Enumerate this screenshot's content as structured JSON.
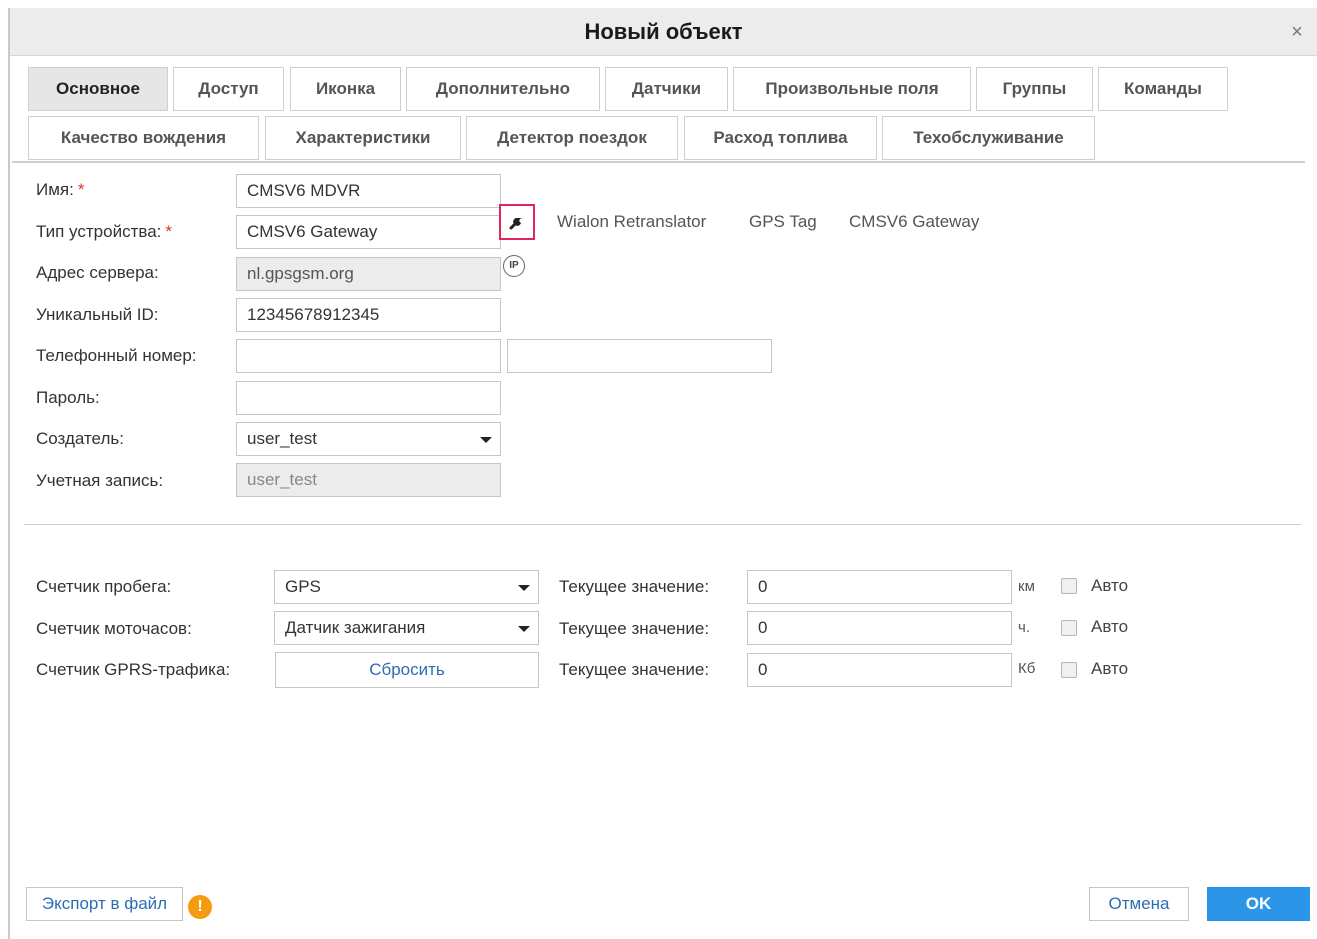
{
  "dialog": {
    "title": "Новый объект",
    "close_glyph": "×"
  },
  "tabs": [
    {
      "label": "Основное",
      "active": true
    },
    {
      "label": "Доступ"
    },
    {
      "label": "Иконка"
    },
    {
      "label": "Дополнительно"
    },
    {
      "label": "Датчики"
    },
    {
      "label": "Произвольные поля"
    },
    {
      "label": "Группы"
    },
    {
      "label": "Команды"
    },
    {
      "label": "Качество вождения"
    },
    {
      "label": "Характеристики"
    },
    {
      "label": "Детектор поездок"
    },
    {
      "label": "Расход топлива"
    },
    {
      "label": "Техобслуживание"
    }
  ],
  "form": {
    "name_label": "Имя:",
    "name_value": "CMSV6 MDVR",
    "device_type_label": "Тип устройства:",
    "device_type_value": "CMSV6 Gateway",
    "required_mark": "*",
    "device_suggestions": [
      "Wialon Retranslator",
      "GPS Tag",
      "CMSV6 Gateway"
    ],
    "server_label": "Адрес сервера:",
    "server_value": "nl.gpsgsm.org",
    "ip_icon_text": "IP",
    "unique_id_label": "Уникальный ID:",
    "unique_id_value": "12345678912345",
    "phone_label": "Телефонный номер:",
    "phone_value_1": "",
    "phone_value_2": "",
    "password_label": "Пароль:",
    "password_value": "",
    "creator_label": "Создатель:",
    "creator_value": "user_test",
    "account_label": "Учетная запись:",
    "account_value": "user_test"
  },
  "counters": {
    "mileage_label": "Счетчик пробега:",
    "mileage_select": "GPS",
    "engine_label": "Счетчик моточасов:",
    "engine_select": "Датчик зажигания",
    "gprs_label": "Счетчик GPRS-трафика:",
    "gprs_reset": "Сбросить",
    "current_label": "Текущее значение:",
    "mileage_value": "0",
    "engine_value": "0",
    "gprs_value": "0",
    "mileage_unit": "км",
    "engine_unit": "ч.",
    "gprs_unit": "Кб",
    "auto_label": "Авто"
  },
  "footer": {
    "export_label": "Экспорт в файл",
    "warn_glyph": "!",
    "cancel_label": "Отмена",
    "ok_label": "OK"
  },
  "colors": {
    "primary": "#2b96e8",
    "required": "#e0302b",
    "highlight": "#e0265a",
    "warning": "#f39c12"
  }
}
